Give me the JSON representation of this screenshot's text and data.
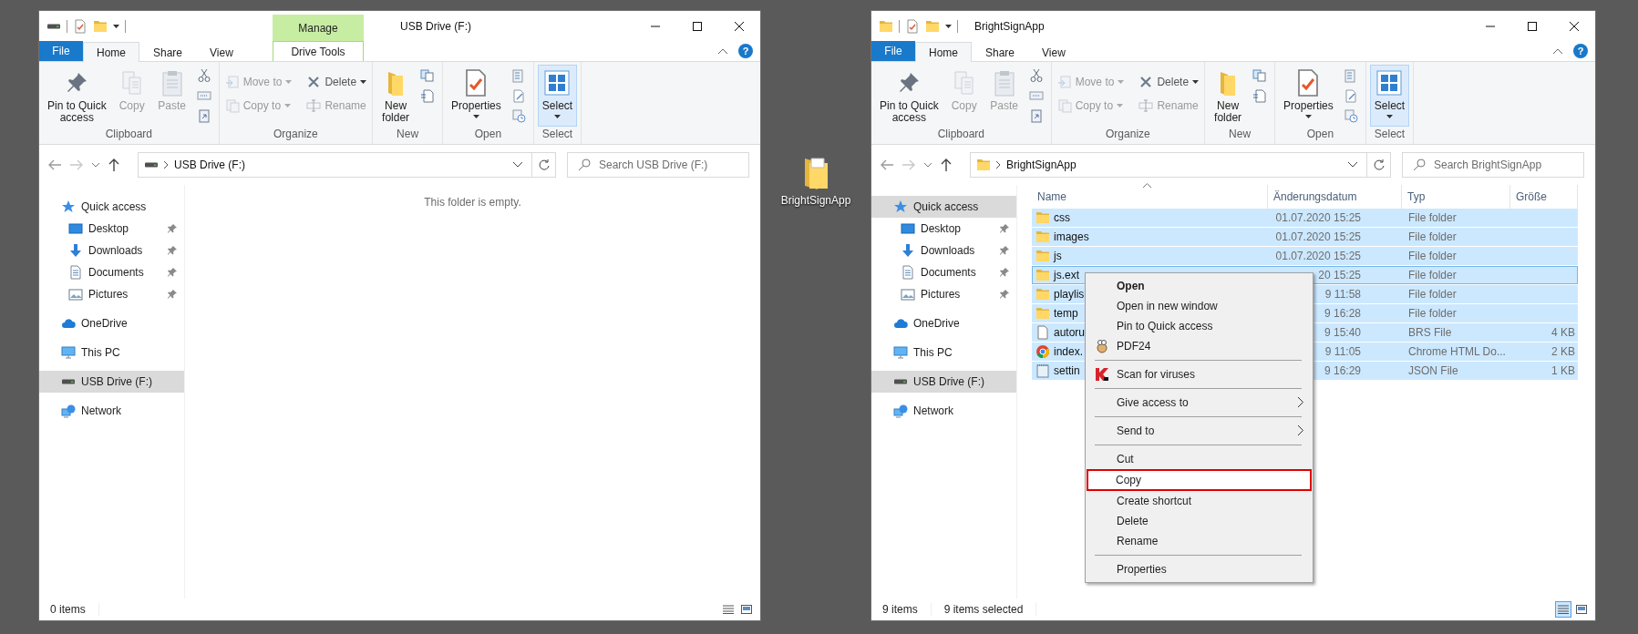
{
  "windows": [
    {
      "title": "USB Drive (F:)",
      "context_tab": {
        "header": "Manage",
        "label": "Drive Tools"
      },
      "help": "?",
      "tabs": [
        {
          "label": "File",
          "kind": "file",
          "selected": false
        },
        {
          "label": "Home",
          "kind": "tab",
          "selected": true
        },
        {
          "label": "Share",
          "kind": "tab",
          "selected": false
        },
        {
          "label": "View",
          "kind": "tab",
          "selected": false
        }
      ],
      "ribbon": [
        {
          "label": "Clipboard",
          "buttons": [
            {
              "kind": "large",
              "label": "Pin to Quick\naccess",
              "disabled": false
            },
            {
              "kind": "large",
              "label": "Copy",
              "disabled": true
            },
            {
              "kind": "large",
              "label": "Paste",
              "disabled": true
            },
            {
              "kind": "icon_stack"
            }
          ]
        },
        {
          "label": "Organize",
          "buttons": [
            {
              "kind": "small",
              "label": "Move to",
              "disabled": true,
              "dropdown": true
            },
            {
              "kind": "small",
              "label": "Copy to",
              "disabled": true,
              "dropdown": true
            },
            {
              "kind": "small",
              "label": "Delete",
              "disabled": false,
              "dropdown": true
            },
            {
              "kind": "small",
              "label": "Rename",
              "disabled": true
            }
          ]
        },
        {
          "label": "New",
          "buttons": [
            {
              "kind": "large",
              "label": "New\nfolder",
              "disabled": false
            },
            {
              "kind": "icon_stack"
            }
          ]
        },
        {
          "label": "Open",
          "buttons": [
            {
              "kind": "large",
              "label": "Properties",
              "disabled": false,
              "dropdown": true
            },
            {
              "kind": "icon_stack"
            }
          ]
        },
        {
          "label": "Select",
          "buttons": [
            {
              "kind": "large",
              "label": "Select",
              "disabled": false,
              "dropdown": true,
              "highlighted": true
            }
          ]
        }
      ],
      "address": {
        "kind": "drive",
        "location": "USB Drive (F:)",
        "search_placeholder": "Search USB Drive (F:)"
      },
      "sidebar": [
        {
          "label": "Quick access",
          "selected": false,
          "children": [
            {
              "label": "Desktop",
              "selected": false,
              "pinned": true
            },
            {
              "label": "Downloads",
              "selected": false,
              "pinned": true
            },
            {
              "label": "Documents",
              "selected": false,
              "pinned": true
            },
            {
              "label": "Pictures",
              "selected": false,
              "pinned": true
            }
          ]
        },
        {
          "label": "OneDrive",
          "selected": false
        },
        {
          "label": "This PC",
          "selected": false
        },
        {
          "label": "USB Drive (F:)",
          "selected": true
        },
        {
          "label": "Network",
          "selected": false
        }
      ],
      "empty_message": "This folder is empty.",
      "status": {
        "texts": [
          "0 items"
        ],
        "view_buttons": [
          {
            "selected": false
          },
          {
            "selected": false
          }
        ]
      }
    },
    {
      "title": "BrightSignApp",
      "help": "?",
      "tabs": [
        {
          "label": "File",
          "kind": "file",
          "selected": false
        },
        {
          "label": "Home",
          "kind": "tab",
          "selected": true
        },
        {
          "label": "Share",
          "kind": "tab",
          "selected": false
        },
        {
          "label": "View",
          "kind": "tab",
          "selected": false
        }
      ],
      "ribbon": [
        {
          "label": "Clipboard",
          "buttons": [
            {
              "kind": "large",
              "label": "Pin to Quick\naccess",
              "disabled": false
            },
            {
              "kind": "large",
              "label": "Copy",
              "disabled": true
            },
            {
              "kind": "large",
              "label": "Paste",
              "disabled": true
            },
            {
              "kind": "icon_stack"
            }
          ]
        },
        {
          "label": "Organize",
          "buttons": [
            {
              "kind": "small",
              "label": "Move to",
              "disabled": true,
              "dropdown": true
            },
            {
              "kind": "small",
              "label": "Copy to",
              "disabled": true,
              "dropdown": true
            },
            {
              "kind": "small",
              "label": "Delete",
              "disabled": false,
              "dropdown": true
            },
            {
              "kind": "small",
              "label": "Rename",
              "disabled": true
            }
          ]
        },
        {
          "label": "New",
          "buttons": [
            {
              "kind": "large",
              "label": "New\nfolder",
              "disabled": false
            },
            {
              "kind": "icon_stack"
            }
          ]
        },
        {
          "label": "Open",
          "buttons": [
            {
              "kind": "large",
              "label": "Properties",
              "disabled": false,
              "dropdown": true
            },
            {
              "kind": "icon_stack"
            }
          ]
        },
        {
          "label": "Select",
          "buttons": [
            {
              "kind": "large",
              "label": "Select",
              "disabled": false,
              "dropdown": true,
              "highlighted": true
            }
          ]
        }
      ],
      "address": {
        "kind": "folder",
        "location": "BrightSignApp",
        "search_placeholder": "Search BrightSignApp"
      },
      "sidebar": [
        {
          "label": "Quick access",
          "selected": true,
          "children": [
            {
              "label": "Desktop",
              "selected": false,
              "pinned": true
            },
            {
              "label": "Downloads",
              "selected": false,
              "pinned": true
            },
            {
              "label": "Documents",
              "selected": false,
              "pinned": true
            },
            {
              "label": "Pictures",
              "selected": false,
              "pinned": true
            }
          ]
        },
        {
          "label": "OneDrive",
          "selected": false
        },
        {
          "label": "This PC",
          "selected": false
        },
        {
          "label": "USB Drive (F:)",
          "selected": true
        },
        {
          "label": "Network",
          "selected": false
        }
      ],
      "file_list": {
        "columns": [
          "Name",
          "Änderungsdatum",
          "Typ",
          "Größe"
        ],
        "rows": [
          {
            "kind": "folder",
            "name": "css",
            "date": "01.07.2020 15:25",
            "type": "File folder",
            "selected": true,
            "focused": false
          },
          {
            "kind": "folder",
            "name": "images",
            "date": "01.07.2020 15:25",
            "type": "File folder",
            "selected": true,
            "focused": false
          },
          {
            "kind": "folder",
            "name": "js",
            "date": "01.07.2020 15:25",
            "type": "File folder",
            "selected": true,
            "focused": false
          },
          {
            "kind": "folder",
            "name": "js.ext",
            "date": "20 15:25",
            "type": "File folder",
            "selected": true,
            "focused": true
          },
          {
            "kind": "folder",
            "name": "playlis",
            "date": "9 11:58",
            "type": "File folder",
            "selected": true,
            "focused": false
          },
          {
            "kind": "folder",
            "name": "temp",
            "date": "9 16:28",
            "type": "File folder",
            "selected": true,
            "focused": false
          },
          {
            "kind": "file",
            "name": "autoru",
            "date": "9 15:40",
            "type": "BRS File",
            "size": "4 KB",
            "selected": true,
            "focused": false
          },
          {
            "kind": "chrome",
            "name": "index.",
            "date": "9 11:05",
            "type": "Chrome HTML Do...",
            "size": "2 KB",
            "selected": true,
            "focused": false
          },
          {
            "kind": "json",
            "name": "settin",
            "date": "9 16:29",
            "type": "JSON File",
            "size": "1 KB",
            "selected": true,
            "focused": false
          }
        ]
      },
      "context_menu": [
        {
          "kind": "item",
          "label": "Open",
          "default": true
        },
        {
          "kind": "item",
          "label": "Open in new window"
        },
        {
          "kind": "item",
          "label": "Pin to Quick access"
        },
        {
          "kind": "item",
          "label": "PDF24",
          "icon": true
        },
        {
          "kind": "separator"
        },
        {
          "kind": "item",
          "label": "Scan for viruses",
          "icon": true
        },
        {
          "kind": "separator"
        },
        {
          "kind": "item",
          "label": "Give access to",
          "submenu": true
        },
        {
          "kind": "separator"
        },
        {
          "kind": "item",
          "label": "Send to",
          "submenu": true
        },
        {
          "kind": "separator"
        },
        {
          "kind": "item",
          "label": "Cut"
        },
        {
          "kind": "item",
          "label": "Copy",
          "highlighted": true
        },
        {
          "kind": "item",
          "label": "Create shortcut"
        },
        {
          "kind": "item",
          "label": "Delete"
        },
        {
          "kind": "item",
          "label": "Rename"
        },
        {
          "kind": "separator"
        },
        {
          "kind": "item",
          "label": "Properties"
        }
      ],
      "status": {
        "texts": [
          "9 items",
          "9 items selected"
        ],
        "view_buttons": [
          {
            "selected": true
          },
          {
            "selected": false
          }
        ]
      }
    }
  ],
  "desktop_icon": {
    "label": "BrightSignApp"
  }
}
